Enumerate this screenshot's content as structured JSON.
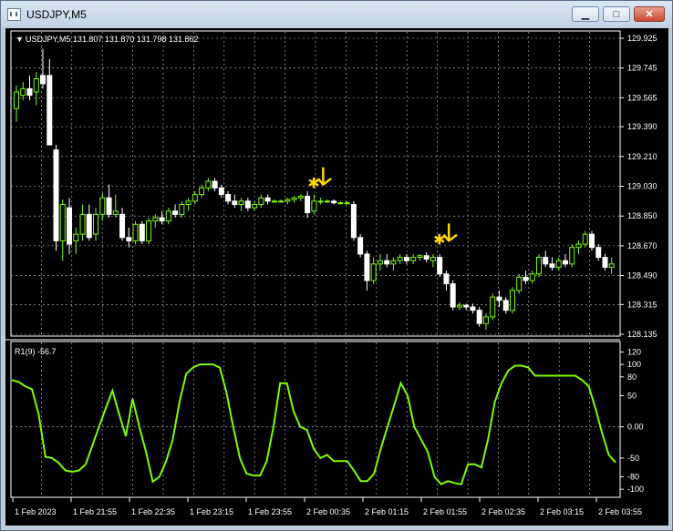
{
  "window": {
    "title": "USDJPY,M5",
    "minimize_glyph": "▁",
    "maximize_glyph": "□",
    "close_glyph": "✕"
  },
  "chart_info": {
    "label": "USDJPY,M5  131.807 131.870 131.798 131.862",
    "menu_glyph": "▼"
  },
  "indicator": {
    "label": "R1(9) -56.7",
    "levels": [
      "120",
      "100",
      "80",
      "50",
      "0.00",
      "-50",
      "-80",
      "-100"
    ]
  },
  "time_labels": [
    "1 Feb 2023",
    "1 Feb 21:55",
    "1 Feb 22:35",
    "1 Feb 23:15",
    "1 Feb 23:55",
    "2 Feb 00:35",
    "2 Feb 01:15",
    "2 Feb 01:55",
    "2 Feb 02:35",
    "2 Feb 03:15",
    "2 Feb 03:55"
  ],
  "colors": {
    "background": "#000000",
    "grid": "#c8c8c8",
    "bull": "#7cfc00",
    "bear": "#ffffff",
    "doji": "#7cfc00",
    "indicator_line": "#7cfc00",
    "arrow": "#ffd700"
  },
  "chart_data": [
    {
      "type": "candlestick",
      "symbol": "USDJPY",
      "timeframe": "M5",
      "price_axis_labels": [
        "129.925",
        "129.745",
        "129.565",
        "129.390",
        "129.210",
        "129.030",
        "128.850",
        "128.670",
        "128.490",
        "128.315",
        "128.135"
      ],
      "ylim": [
        128.135,
        129.925
      ],
      "candles": [
        {
          "o": 129.5,
          "h": 129.64,
          "l": 129.42,
          "c": 129.6
        },
        {
          "o": 129.58,
          "h": 129.66,
          "l": 129.55,
          "c": 129.62
        },
        {
          "o": 129.62,
          "h": 129.7,
          "l": 129.55,
          "c": 129.58
        },
        {
          "o": 129.6,
          "h": 129.72,
          "l": 129.52,
          "c": 129.68
        },
        {
          "o": 129.7,
          "h": 129.86,
          "l": 129.62,
          "c": 129.65
        },
        {
          "o": 129.7,
          "h": 129.8,
          "l": 129.3,
          "c": 129.28
        },
        {
          "o": 129.25,
          "h": 129.28,
          "l": 128.64,
          "c": 128.7
        },
        {
          "o": 128.7,
          "h": 128.95,
          "l": 128.58,
          "c": 128.92
        },
        {
          "o": 128.9,
          "h": 128.96,
          "l": 128.62,
          "c": 128.68
        },
        {
          "o": 128.7,
          "h": 128.78,
          "l": 128.62,
          "c": 128.74
        },
        {
          "o": 128.74,
          "h": 128.92,
          "l": 128.7,
          "c": 128.86
        },
        {
          "o": 128.86,
          "h": 128.92,
          "l": 128.7,
          "c": 128.72
        },
        {
          "o": 128.74,
          "h": 128.9,
          "l": 128.7,
          "c": 128.86
        },
        {
          "o": 128.86,
          "h": 128.99,
          "l": 128.82,
          "c": 128.96
        },
        {
          "o": 128.96,
          "h": 129.04,
          "l": 128.84,
          "c": 128.86
        },
        {
          "o": 128.86,
          "h": 128.98,
          "l": 128.84,
          "c": 128.88
        },
        {
          "o": 128.86,
          "h": 128.9,
          "l": 128.7,
          "c": 128.72
        },
        {
          "o": 128.72,
          "h": 128.78,
          "l": 128.66,
          "c": 128.7
        },
        {
          "o": 128.7,
          "h": 128.82,
          "l": 128.68,
          "c": 128.8
        },
        {
          "o": 128.8,
          "h": 128.82,
          "l": 128.68,
          "c": 128.7
        },
        {
          "o": 128.7,
          "h": 128.84,
          "l": 128.68,
          "c": 128.82
        },
        {
          "o": 128.82,
          "h": 128.86,
          "l": 128.78,
          "c": 128.84
        },
        {
          "o": 128.84,
          "h": 128.88,
          "l": 128.8,
          "c": 128.82
        },
        {
          "o": 128.82,
          "h": 128.9,
          "l": 128.8,
          "c": 128.88
        },
        {
          "o": 128.88,
          "h": 128.92,
          "l": 128.84,
          "c": 128.86
        },
        {
          "o": 128.86,
          "h": 128.94,
          "l": 128.84,
          "c": 128.92
        },
        {
          "o": 128.92,
          "h": 128.96,
          "l": 128.88,
          "c": 128.94
        },
        {
          "o": 128.94,
          "h": 129.0,
          "l": 128.92,
          "c": 128.98
        },
        {
          "o": 128.98,
          "h": 129.04,
          "l": 128.96,
          "c": 129.02
        },
        {
          "o": 129.02,
          "h": 129.08,
          "l": 129.0,
          "c": 129.06
        },
        {
          "o": 129.06,
          "h": 129.08,
          "l": 129.0,
          "c": 129.02
        },
        {
          "o": 129.02,
          "h": 129.04,
          "l": 128.96,
          "c": 128.98
        },
        {
          "o": 128.98,
          "h": 129.0,
          "l": 128.92,
          "c": 128.94
        },
        {
          "o": 128.94,
          "h": 128.98,
          "l": 128.9,
          "c": 128.92
        },
        {
          "o": 128.92,
          "h": 128.96,
          "l": 128.88,
          "c": 128.94
        },
        {
          "o": 128.94,
          "h": 128.96,
          "l": 128.88,
          "c": 128.9
        },
        {
          "o": 128.9,
          "h": 128.94,
          "l": 128.88,
          "c": 128.92
        },
        {
          "o": 128.92,
          "h": 128.98,
          "l": 128.9,
          "c": 128.96
        },
        {
          "o": 128.96,
          "h": 128.98,
          "l": 128.92,
          "c": 128.94
        },
        {
          "o": 128.94,
          "h": 128.95,
          "l": 128.93,
          "c": 128.94
        },
        {
          "o": 128.94,
          "h": 128.95,
          "l": 128.93,
          "c": 128.94
        },
        {
          "o": 128.94,
          "h": 128.96,
          "l": 128.92,
          "c": 128.95
        },
        {
          "o": 128.95,
          "h": 128.97,
          "l": 128.93,
          "c": 128.96
        },
        {
          "o": 128.96,
          "h": 128.98,
          "l": 128.94,
          "c": 128.97
        },
        {
          "o": 128.97,
          "h": 129.0,
          "l": 128.84,
          "c": 128.87
        },
        {
          "o": 128.88,
          "h": 128.98,
          "l": 128.86,
          "c": 128.94
        },
        {
          "o": 128.94,
          "h": 128.96,
          "l": 128.92,
          "c": 128.94
        },
        {
          "o": 128.94,
          "h": 128.95,
          "l": 128.93,
          "c": 128.94
        },
        {
          "o": 128.94,
          "h": 128.95,
          "l": 128.92,
          "c": 128.93
        },
        {
          "o": 128.93,
          "h": 128.94,
          "l": 128.92,
          "c": 128.93
        },
        {
          "o": 128.93,
          "h": 128.94,
          "l": 128.92,
          "c": 128.93
        },
        {
          "o": 128.92,
          "h": 128.94,
          "l": 128.7,
          "c": 128.72
        },
        {
          "o": 128.72,
          "h": 128.74,
          "l": 128.6,
          "c": 128.62
        },
        {
          "o": 128.62,
          "h": 128.64,
          "l": 128.4,
          "c": 128.46
        },
        {
          "o": 128.46,
          "h": 128.6,
          "l": 128.44,
          "c": 128.56
        },
        {
          "o": 128.56,
          "h": 128.62,
          "l": 128.52,
          "c": 128.58
        },
        {
          "o": 128.58,
          "h": 128.62,
          "l": 128.54,
          "c": 128.56
        },
        {
          "o": 128.56,
          "h": 128.6,
          "l": 128.52,
          "c": 128.58
        },
        {
          "o": 128.58,
          "h": 128.62,
          "l": 128.56,
          "c": 128.6
        },
        {
          "o": 128.6,
          "h": 128.62,
          "l": 128.56,
          "c": 128.58
        },
        {
          "o": 128.58,
          "h": 128.62,
          "l": 128.56,
          "c": 128.6
        },
        {
          "o": 128.6,
          "h": 128.62,
          "l": 128.58,
          "c": 128.61
        },
        {
          "o": 128.61,
          "h": 128.63,
          "l": 128.57,
          "c": 128.59
        },
        {
          "o": 128.58,
          "h": 128.62,
          "l": 128.54,
          "c": 128.6
        },
        {
          "o": 128.6,
          "h": 128.62,
          "l": 128.48,
          "c": 128.5
        },
        {
          "o": 128.5,
          "h": 128.52,
          "l": 128.4,
          "c": 128.44
        },
        {
          "o": 128.44,
          "h": 128.46,
          "l": 128.28,
          "c": 128.3
        },
        {
          "o": 128.3,
          "h": 128.33,
          "l": 128.28,
          "c": 128.31
        },
        {
          "o": 128.31,
          "h": 128.32,
          "l": 128.28,
          "c": 128.3
        },
        {
          "o": 128.3,
          "h": 128.32,
          "l": 128.26,
          "c": 128.28
        },
        {
          "o": 128.28,
          "h": 128.3,
          "l": 128.18,
          "c": 128.2
        },
        {
          "o": 128.2,
          "h": 128.26,
          "l": 128.16,
          "c": 128.24
        },
        {
          "o": 128.24,
          "h": 128.38,
          "l": 128.22,
          "c": 128.36
        },
        {
          "o": 128.36,
          "h": 128.4,
          "l": 128.3,
          "c": 128.34
        },
        {
          "o": 128.34,
          "h": 128.36,
          "l": 128.26,
          "c": 128.28
        },
        {
          "o": 128.28,
          "h": 128.42,
          "l": 128.26,
          "c": 128.4
        },
        {
          "o": 128.4,
          "h": 128.5,
          "l": 128.38,
          "c": 128.48
        },
        {
          "o": 128.48,
          "h": 128.52,
          "l": 128.44,
          "c": 128.46
        },
        {
          "o": 128.46,
          "h": 128.52,
          "l": 128.44,
          "c": 128.5
        },
        {
          "o": 128.5,
          "h": 128.62,
          "l": 128.48,
          "c": 128.6
        },
        {
          "o": 128.6,
          "h": 128.64,
          "l": 128.54,
          "c": 128.56
        },
        {
          "o": 128.56,
          "h": 128.6,
          "l": 128.52,
          "c": 128.54
        },
        {
          "o": 128.54,
          "h": 128.6,
          "l": 128.52,
          "c": 128.58
        },
        {
          "o": 128.58,
          "h": 128.62,
          "l": 128.54,
          "c": 128.56
        },
        {
          "o": 128.56,
          "h": 128.68,
          "l": 128.54,
          "c": 128.66
        },
        {
          "o": 128.66,
          "h": 128.7,
          "l": 128.62,
          "c": 128.68
        },
        {
          "o": 128.68,
          "h": 128.76,
          "l": 128.66,
          "c": 128.74
        },
        {
          "o": 128.74,
          "h": 128.76,
          "l": 128.64,
          "c": 128.66
        },
        {
          "o": 128.66,
          "h": 128.68,
          "l": 128.58,
          "c": 128.6
        },
        {
          "o": 128.6,
          "h": 128.62,
          "l": 128.52,
          "c": 128.54
        },
        {
          "o": 128.54,
          "h": 128.6,
          "l": 128.5,
          "c": 128.56
        }
      ],
      "signals": [
        {
          "index": 45,
          "price": 129.04,
          "label": "✱"
        },
        {
          "index": 64,
          "price": 128.7,
          "label": "✱"
        }
      ]
    },
    {
      "type": "line",
      "name": "R1(9)",
      "ylim": [
        -110,
        125
      ],
      "ticks": [
        120,
        100,
        80,
        50,
        0,
        -50,
        -80,
        -100
      ],
      "values": [
        75,
        72,
        65,
        60,
        20,
        -48,
        -50,
        -58,
        -70,
        -72,
        -70,
        -60,
        -30,
        0,
        30,
        58,
        20,
        -15,
        45,
        0,
        -40,
        -88,
        -80,
        -55,
        -20,
        40,
        85,
        95,
        100,
        100,
        100,
        95,
        55,
        0,
        -50,
        -75,
        -78,
        -78,
        -55,
        0,
        70,
        70,
        25,
        0,
        -5,
        -35,
        -50,
        -45,
        -55,
        -55,
        -55,
        -70,
        -87,
        -87,
        -75,
        -35,
        0,
        35,
        70,
        50,
        0,
        -20,
        -40,
        -80,
        -92,
        -87,
        -90,
        -92,
        -60,
        -60,
        -65,
        -20,
        40,
        70,
        90,
        98,
        98,
        95,
        82,
        82,
        82,
        82,
        82,
        82,
        82,
        75,
        65,
        30,
        -10,
        -45,
        -57
      ]
    }
  ]
}
